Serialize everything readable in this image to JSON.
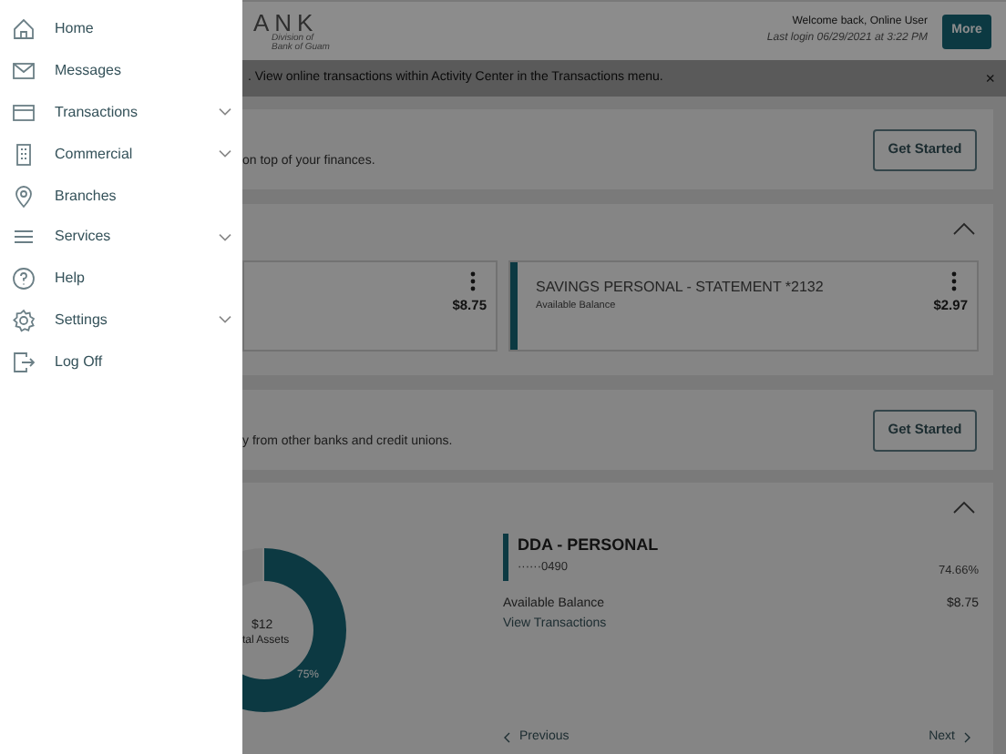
{
  "drawer": {
    "items": [
      {
        "label": "Home",
        "has_submenu": false
      },
      {
        "label": "Messages",
        "has_submenu": false
      },
      {
        "label": "Transactions",
        "has_submenu": true
      },
      {
        "label": "Commercial",
        "has_submenu": true
      },
      {
        "label": "Branches",
        "has_submenu": false
      },
      {
        "label": "Services",
        "has_submenu": true
      },
      {
        "label": "Help",
        "has_submenu": false
      },
      {
        "label": "Settings",
        "has_submenu": true
      },
      {
        "label": "Log Off",
        "has_submenu": false
      }
    ]
  },
  "header": {
    "logo_text": "ANK",
    "logo_subtitle": [
      "Division of",
      "Bank of Guam"
    ],
    "welcome": "Welcome back, Online User",
    "last_login": "Last login 06/29/2021 at 3:22 PM",
    "more_button": "More"
  },
  "banner": {
    "text": ". View online transactions within Activity Center in the Transactions menu.",
    "close": "×"
  },
  "promo_cards": [
    {
      "text": "on top of your finances.",
      "button": "Get Started"
    }
  ],
  "accounts_card": {
    "expanded": true,
    "accounts": [
      {
        "amount": "$8.75"
      },
      {
        "title": "SAVINGS PERSONAL - STATEMENT *2132",
        "subtitle": "Available Balance",
        "amount": "$2.97"
      }
    ]
  },
  "promo_cards_2": [
    {
      "text": "y from other banks and credit unions.",
      "button": "Get Started"
    }
  ],
  "assets_card": {
    "expanded": true,
    "donut": {
      "total": "$12",
      "label": "tal Assets",
      "slice_label": "75%"
    },
    "account": {
      "name": "DDA - PERSONAL",
      "number": "······0490",
      "share": "74.66%",
      "balance_label": "Available Balance",
      "balance": "$8.75",
      "link": "View Transactions"
    },
    "previous": "Previous",
    "next": "Next"
  }
}
